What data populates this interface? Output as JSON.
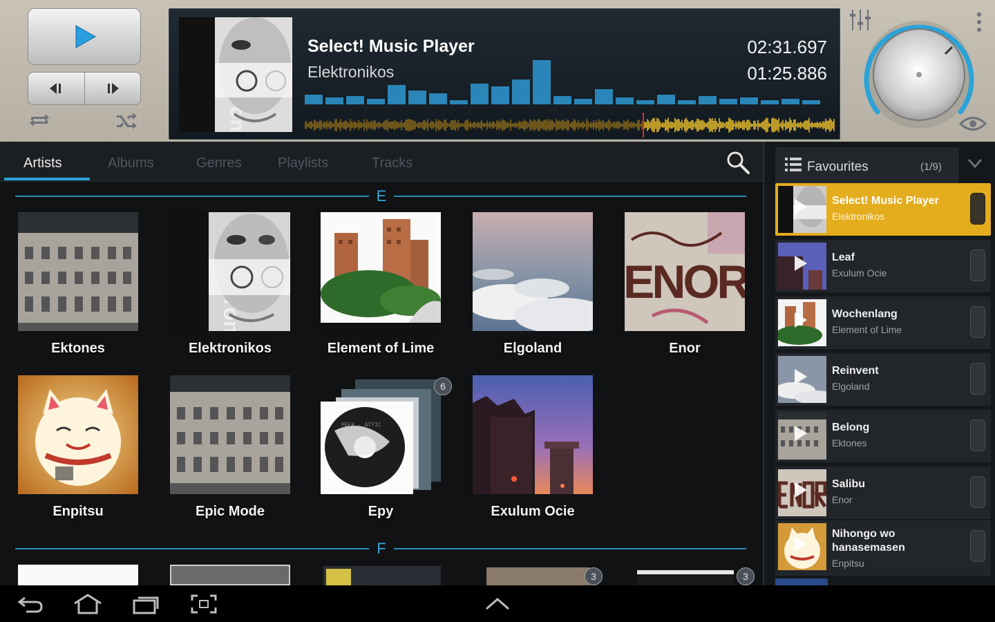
{
  "colors": {
    "accent": "#2aa3d8",
    "current_track": "#e4ad1d",
    "waveform": "#e0b21e",
    "spectrum": "#2a86b8"
  },
  "player": {
    "title": "Select! Music Player",
    "artist": "Elektronikos",
    "elapsed": "02:31.697",
    "remaining": "01:25.886",
    "icons": {
      "play": "play-icon",
      "prev": "previous-icon",
      "next": "next-icon",
      "repeat": "repeat-icon",
      "shuffle": "shuffle-icon",
      "eq": "equalizer-icon",
      "menu": "overflow-menu-icon",
      "visualizer": "eye-icon",
      "volume": "volume-knob"
    }
  },
  "tabs": [
    {
      "label": "Artists",
      "active": true
    },
    {
      "label": "Albums"
    },
    {
      "label": "Genres"
    },
    {
      "label": "Playlists"
    },
    {
      "label": "Tracks"
    }
  ],
  "sections": [
    {
      "letter": "E"
    },
    {
      "letter": "F"
    }
  ],
  "artists": [
    {
      "name": "Ektones"
    },
    {
      "name": "Elektronikos"
    },
    {
      "name": "Element of Lime"
    },
    {
      "name": "Elgoland"
    },
    {
      "name": "Enor"
    },
    {
      "name": "Enpitsu"
    },
    {
      "name": "Epic Mode"
    },
    {
      "name": "Epy",
      "badge": "6"
    },
    {
      "name": "Exulum Ocie"
    }
  ],
  "f_row_badges": [
    "3",
    "3"
  ],
  "favourites": {
    "title": "Favourites",
    "count": "(1/9)",
    "items": [
      {
        "title": "Select! Music Player",
        "artist": "Elektronikos",
        "current": true
      },
      {
        "title": "Leaf",
        "artist": "Exulum Ocie"
      },
      {
        "title": "Wochenlang",
        "artist": "Element of Lime"
      },
      {
        "title": "Reinvent",
        "artist": "Elgoland"
      },
      {
        "title": "Belong",
        "artist": "Ektones"
      },
      {
        "title": "Salibu",
        "artist": "Enor"
      },
      {
        "title": "Nihongo wo hanasemasen",
        "artist": "Enpitsu"
      }
    ]
  },
  "navbar": {
    "icons": [
      "back-icon",
      "home-icon",
      "recent-apps-icon",
      "screenshot-icon",
      "up-chevron-icon"
    ]
  }
}
